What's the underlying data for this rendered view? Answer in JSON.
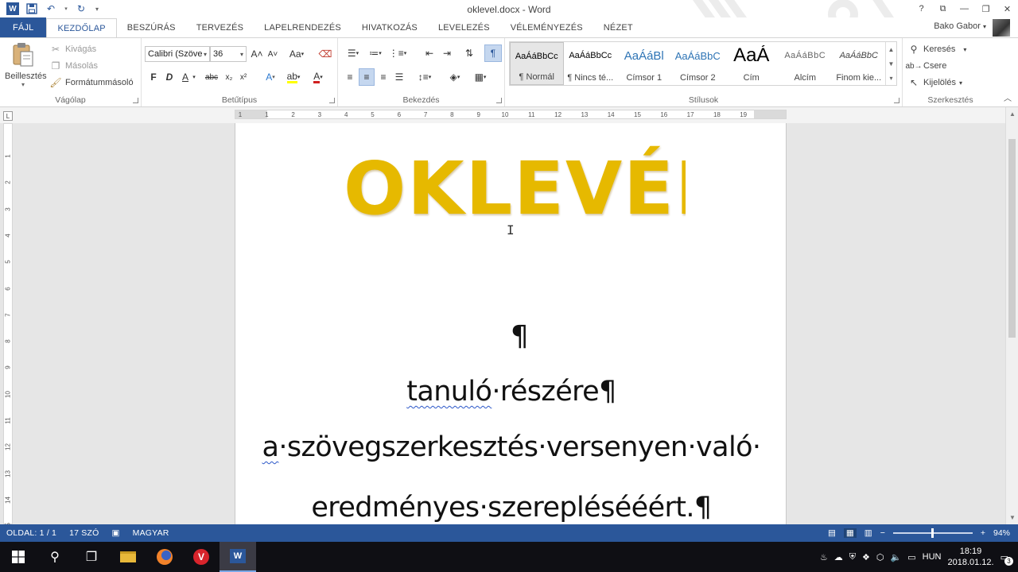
{
  "window": {
    "title": "oklevel.docx - Word",
    "user": "Bako Gabor",
    "help": "?",
    "controls": [
      "⧉",
      "—",
      "❐",
      "✕"
    ]
  },
  "qat": {
    "undo": "↶",
    "redo": "↻"
  },
  "tabs": [
    {
      "label": "FÁJL"
    },
    {
      "label": "KEZDŐLAP"
    },
    {
      "label": "BESZÚRÁS"
    },
    {
      "label": "TERVEZÉS"
    },
    {
      "label": "LAPELRENDEZÉS"
    },
    {
      "label": "HIVATKOZÁS"
    },
    {
      "label": "LEVELEZÉS"
    },
    {
      "label": "VÉLEMÉNYEZÉS"
    },
    {
      "label": "NÉZET"
    }
  ],
  "ribbon": {
    "clipboard": {
      "paste": "Beillesztés",
      "cut": "Kivágás",
      "copy": "Másolás",
      "format_painter": "Formátummásoló",
      "label": "Vágólap"
    },
    "font": {
      "name": "Calibri (Szöve",
      "size": "36",
      "bold": "F",
      "italic": "D",
      "underline": "A",
      "strike": "abc",
      "sub": "x₂",
      "sup": "x²",
      "grow": "A˄",
      "shrink": "A˅",
      "case": "Aa",
      "label": "Betűtípus"
    },
    "paragraph": {
      "label": "Bekezdés"
    },
    "styles": {
      "label": "Stílusok",
      "items": [
        {
          "preview": "AaÁáBbCc",
          "name": "¶ Normál"
        },
        {
          "preview": "AaÁáBbCc",
          "name": "¶ Nincs té..."
        },
        {
          "preview": "AaÁáBl",
          "name": "Címsor 1"
        },
        {
          "preview": "AaÁáBbC",
          "name": "Címsor 2"
        },
        {
          "preview": "AaÁ",
          "name": "Cím"
        },
        {
          "preview": "AaÁáBbC",
          "name": "Alcím"
        },
        {
          "preview": "AaÁáBbC",
          "name": "Finom kie..."
        }
      ]
    },
    "editing": {
      "label": "Szerkesztés",
      "find": "Keresés",
      "replace": "Csere",
      "select": "Kijelölés"
    }
  },
  "ruler": {
    "h_ticks": [
      "1",
      "1",
      "2",
      "3",
      "4",
      "5",
      "6",
      "7",
      "8",
      "9",
      "10",
      "11",
      "12",
      "13",
      "14",
      "15",
      "16",
      "17",
      "18",
      "19"
    ],
    "v_ticks": [
      "1",
      "2",
      "3",
      "4",
      "5",
      "6",
      "7",
      "8",
      "9",
      "10",
      "11",
      "12",
      "13",
      "14",
      "15"
    ]
  },
  "document": {
    "title": "OKLEVÉL",
    "p1": "¶",
    "p2_word": "tanuló",
    "p2_rest": "·részére¶",
    "p3_word": "a",
    "p3_rest": "·szövegszerkesztés·versenyen·való·",
    "p4": "eredményes·szereplésééért.¶"
  },
  "status": {
    "page": "OLDAL: 1 / 1",
    "words": "17 SZÓ",
    "language": "MAGYAR",
    "zoom": "94%"
  },
  "taskbar": {
    "lang": "HUN",
    "time": "18:19",
    "date": "2018.01.12.",
    "notifications": "3"
  },
  "colors": {
    "accent": "#2b579a",
    "title_gold": "#e6b900"
  }
}
